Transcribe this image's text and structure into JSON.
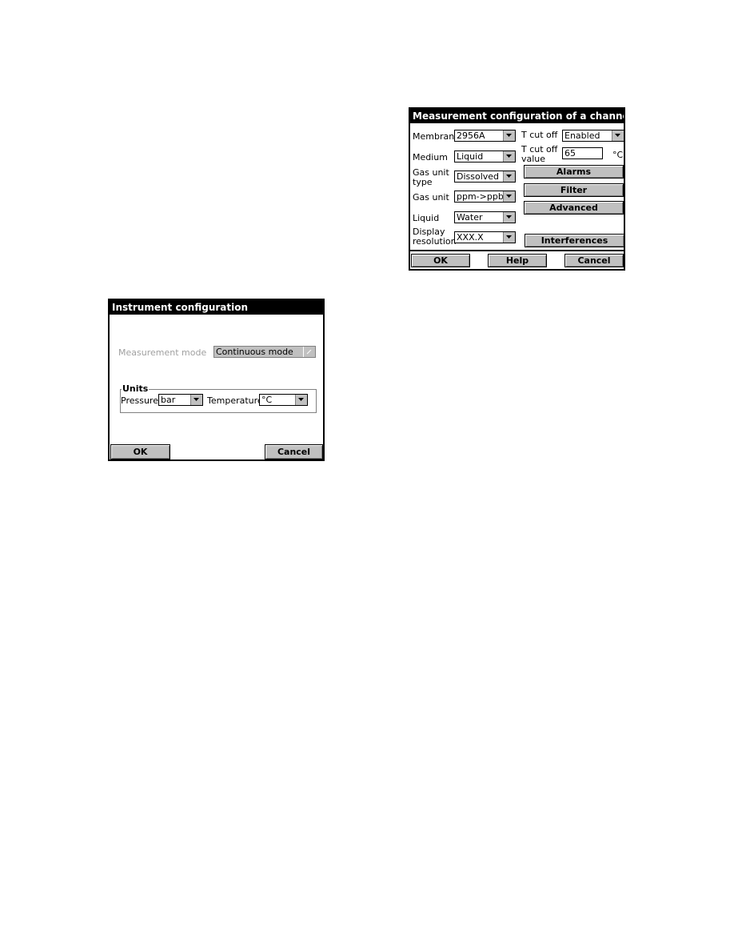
{
  "channel_dialog": {
    "title": "Measurement configuration of a channel",
    "fields": [
      {
        "label": "Membrane",
        "value": "2956A"
      },
      {
        "label": "Medium",
        "value": "Liquid"
      },
      {
        "label_line1": "Gas unit",
        "label_line2": "type",
        "value": "Dissolved"
      },
      {
        "label": "Gas unit",
        "value": "ppm->ppb"
      },
      {
        "label": "Liquid",
        "value": "Water"
      },
      {
        "label_line1": "Display",
        "label_line2": "resolution",
        "value": "XXX.X"
      }
    ],
    "t_cut_off": {
      "label": "T cut off",
      "value": "Enabled"
    },
    "t_cut_off_value": {
      "label_line1": "T cut off",
      "label_line2": "value",
      "value": "65",
      "unit": "°C"
    },
    "buttons": {
      "alarms": "Alarms",
      "filter": "Filter",
      "advanced": "Advanced",
      "interferences": "Interferences",
      "ok": "OK",
      "help": "Help",
      "cancel": "Cancel"
    }
  },
  "instrument_dialog": {
    "title": "Instrument configuration",
    "measurement_mode": {
      "label": "Measurement mode",
      "value": "Continuous mode",
      "enabled": false
    },
    "units_group": {
      "title": "Units",
      "pressure": {
        "label": "Pressure",
        "value": "bar"
      },
      "temperature": {
        "label": "Temperature",
        "value": "°C"
      }
    },
    "buttons": {
      "ok": "OK",
      "cancel": "Cancel"
    }
  }
}
